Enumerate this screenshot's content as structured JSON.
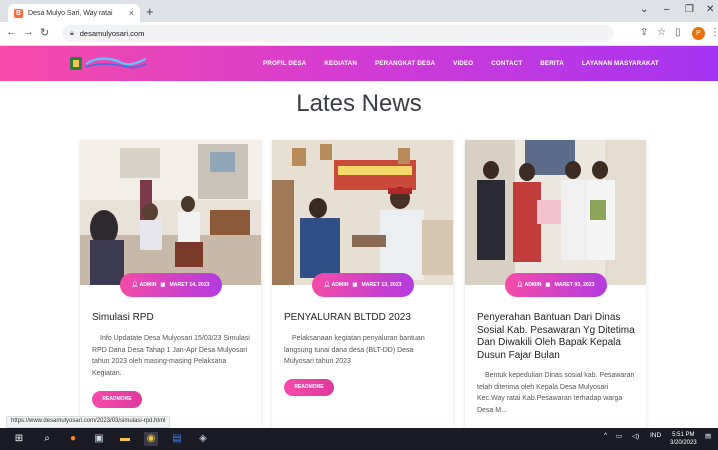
{
  "browser": {
    "tab_title": "Desa Mulyo Sari, Way ratai",
    "tab_close": "×",
    "new_tab": "+",
    "url": "desamulyosari.com",
    "status_url": "https://www.desamulyosari.com/2023/03/simulasi-rpd.html",
    "profile_initial": "P"
  },
  "site": {
    "nav": [
      "PROFIL DESA",
      "KEGIATAN",
      "PERANGKAT DESA",
      "VIDEO",
      "CONTACT",
      "BERITA",
      "LAYANAN MASYARAKAT"
    ],
    "heading": "Lates News",
    "cards": [
      {
        "author": "ADMIN",
        "date": "MARET 14, 2023",
        "title": "Simulasi RPD",
        "excerpt": "Info Updatate Desa Mulyosari 15/03/23 Simulasi RPD Dana Desa Tahap 1 Jan-Apr Desa Mulyosari tahun 2023 oleh masing-masing Pelaksana Kegiatan.",
        "button": "READMORE"
      },
      {
        "author": "ADMIN",
        "date": "MARET 13, 2023",
        "title": "PENYALURAN BLTDD 2023",
        "excerpt": "Pelaksanaan kegiatan penyaluran bantuan langsung tunai dana desa (BLT-DD) Desa Mulyosari tahun 2023",
        "button": "READMORE"
      },
      {
        "author": "ADMIN",
        "date": "MARET 03, 2023",
        "title": "Penyerahan Bantuan Dari Dinas Sosial Kab. Pesawaran Yg Ditetima Dan Diwakili Oleh Bapak Kepala Dusun Fajar Bulan",
        "excerpt": "Bentuk kepedulian Dinas sosial kab. Pesawaran telah diterima oleh Kepala Desa Mulyosari Kec.Way ratai Kab.Pesawaran terhadap warga Desa M...",
        "button": ""
      }
    ]
  },
  "taskbar": {
    "lang": "IND",
    "time": "5:51 PM",
    "date": "3/20/2023"
  },
  "colors": {
    "nav_gradient_start": "#f64ba8",
    "nav_gradient_end": "#a534f2",
    "button_pink": "#f64ba8"
  }
}
